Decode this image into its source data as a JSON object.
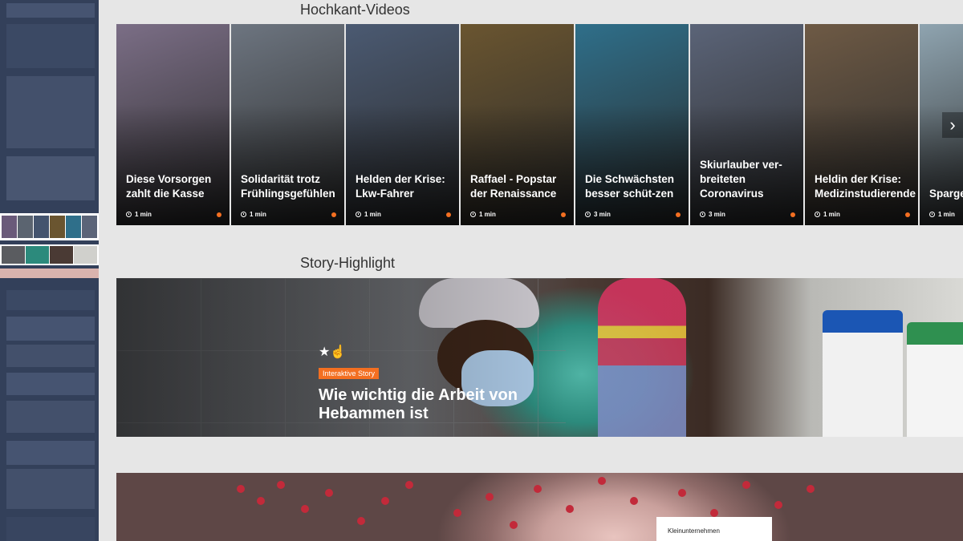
{
  "sections": {
    "videos_heading": "Hochkant-Videos",
    "story_heading": "Story-Highlight"
  },
  "video_cards": [
    {
      "title": "Diese Vorsorgen zahlt die Kasse",
      "duration": "1 min",
      "bg": "#7b6e86"
    },
    {
      "title": "Solidarität trotz Frühlingsgefühlen",
      "duration": "1 min",
      "bg": "#6d7580"
    },
    {
      "title": "Helden der Krise: Lkw-Fahrer",
      "duration": "1 min",
      "bg": "#4b5a72"
    },
    {
      "title": "Raffael - Popstar der Renaissance",
      "duration": "1 min",
      "bg": "#6a5530"
    },
    {
      "title": "Die Schwächsten besser schüt-zen",
      "duration": "3 min",
      "bg": "#2f6f8a"
    },
    {
      "title": "Skiurlauber ver-breiteten Coronavirus",
      "duration": "3 min",
      "bg": "#5b6478"
    },
    {
      "title": "Heldin der Krise: Medizinstudierende",
      "duration": "1 min",
      "bg": "#6e5a45"
    },
    {
      "title": "Sparge Darum es!",
      "duration": "1 min",
      "bg": "#8fa4b0"
    }
  ],
  "next_icon": "›",
  "story": {
    "icon": "★☝",
    "badge": "Interaktive Story",
    "title": "Wie wichtig die Arbeit von Hebammen ist"
  },
  "teaser": {
    "label": "Kleinunternehmen"
  },
  "colors": {
    "accent": "#f36f21",
    "rail": "#33405a",
    "page_bg": "#e6e6e6"
  }
}
